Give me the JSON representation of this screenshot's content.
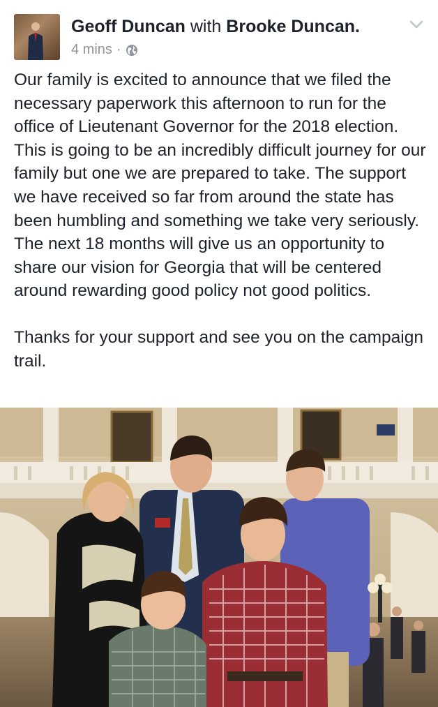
{
  "post": {
    "author": "Geoff Duncan",
    "with_word": "with",
    "tagged": "Brooke Duncan.",
    "timestamp": "4 mins",
    "separator": "·",
    "privacy_icon": "globe-icon",
    "menu_icon": "chevron-down-icon",
    "paragraphs": [
      "Our family is excited to announce that we filed the necessary paperwork this afternoon to run for the office of Lieutenant Governor for the 2018 election. This is going to be an incredibly difficult journey for our family but one we are prepared to take. The support we have received so far from around the state has been humbling and something we take very seriously. The next 18 months will give us an opportunity to share our vision for Georgia that will be centered around rewarding good policy not good politics.",
      "Thanks for your support and see you on the campaign trail."
    ]
  },
  "colors": {
    "text": "#1d2129",
    "meta": "#90949c",
    "chevron": "#bec3c9"
  }
}
